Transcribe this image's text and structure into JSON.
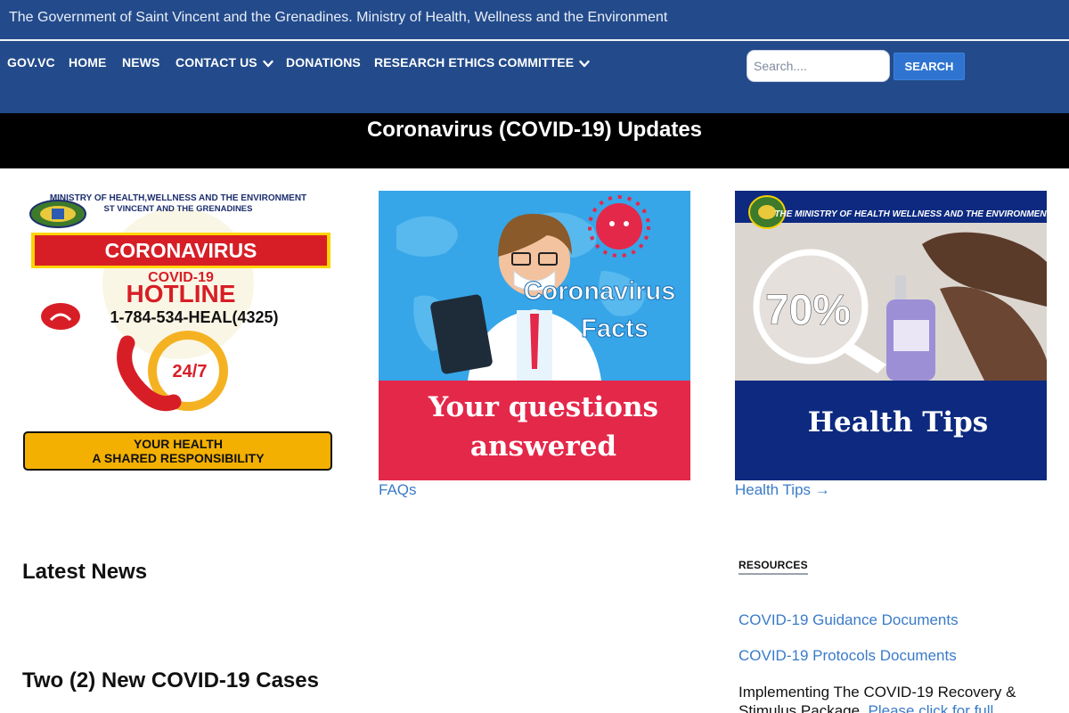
{
  "header": {
    "site_title": "The Government of Saint Vincent and the Grenadines. Ministry of Health, Wellness and the Environment"
  },
  "nav": {
    "items": [
      {
        "label": "GOV.VC"
      },
      {
        "label": "HOME"
      },
      {
        "label": "NEWS"
      },
      {
        "label": "CONTACT US"
      },
      {
        "label": "DONATIONS"
      },
      {
        "label": "RESEARCH ETHICS COMMITTEE"
      }
    ],
    "search_placeholder": "Search....",
    "search_button": "SEARCH"
  },
  "banner": {
    "title": "Coronavirus (COVID-19) Updates"
  },
  "cards": {
    "hotline": {
      "ministry_line1": "MINISTRY OF HEALTH,WELLNESS AND THE ENVIRONMENT",
      "ministry_line2": "ST VINCENT AND THE GRENADINES",
      "coronavirus": "CORONAVIRUS",
      "covid19": "COVID-19",
      "hotline": "HOTLINE",
      "phone": "1-784-534-HEAL(4325)",
      "hours": "24/7",
      "slogan_line1": "YOUR HEALTH",
      "slogan_line2": "A SHARED RESPONSIBILITY"
    },
    "facts": {
      "title_line1": "Coronavirus",
      "title_line2": "Facts",
      "answer_line1": "Your questions",
      "answer_line2": "answered",
      "link": "FAQs"
    },
    "tips": {
      "ministry": "THE MINISTRY OF HEALTH WELLNESS AND THE ENVIRONMENT",
      "percent": "70%",
      "title": "Health Tips",
      "link": "Health Tips →"
    }
  },
  "news": {
    "heading": "Latest News",
    "first_title": "Two (2) New COVID-19 Cases"
  },
  "resources": {
    "label": "RESOURCES",
    "links": [
      {
        "label": "COVID-19 Guidance Documents"
      },
      {
        "label": "COVID-19 Protocols Documents"
      }
    ],
    "recovery_text": "Implementing The COVID-19 Recovery & Stimulus Package.",
    "recovery_link": "Please click for full details"
  },
  "colors": {
    "nav_bg": "#234b8b",
    "link": "#3a7bc8",
    "search_button": "#2f74d0",
    "facts_red": "#e4284a",
    "facts_blue": "#36a6e8",
    "tips_navy": "#0d2a80"
  }
}
